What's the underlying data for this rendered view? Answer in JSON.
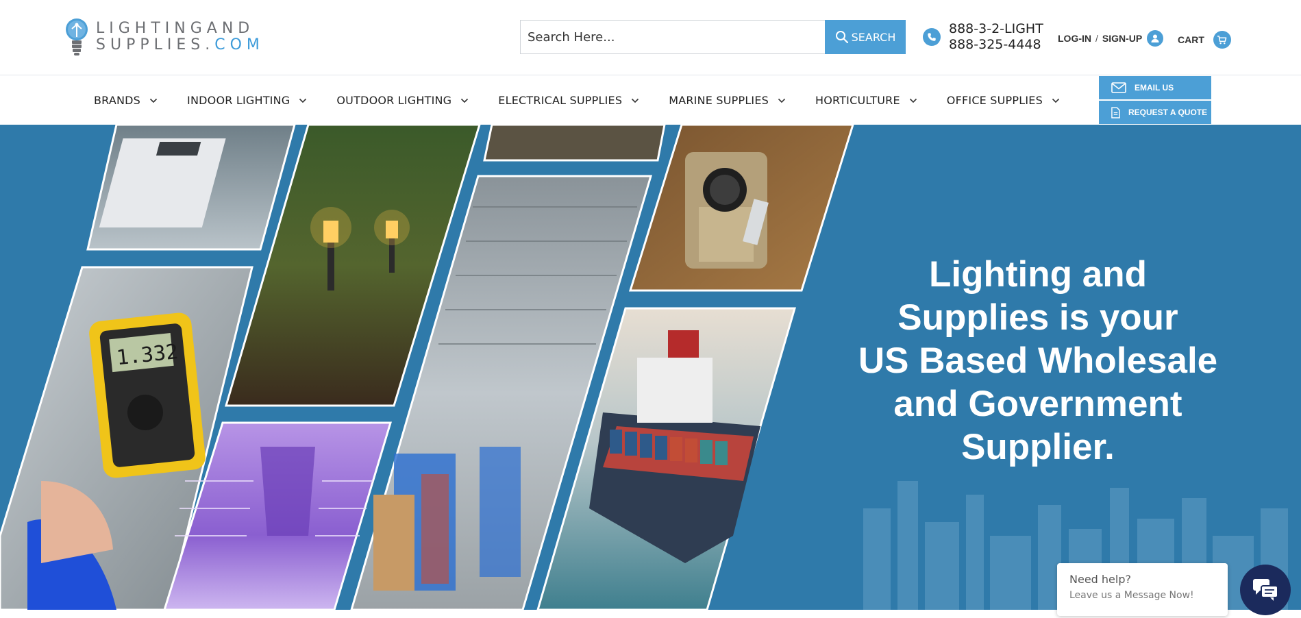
{
  "brand": {
    "line1": "LIGHTINGAND",
    "line2": "SUPPLIES.",
    "line2_suffix": "COM"
  },
  "search": {
    "placeholder": "Search Here...",
    "button_label": "SEARCH"
  },
  "contact": {
    "phone_line1": "888-3-2-LIGHT",
    "phone_line2": "888-325-4448"
  },
  "account": {
    "login_label": "LOG-IN",
    "separator": "/",
    "signup_label": "SIGN-UP"
  },
  "cart": {
    "label": "CART"
  },
  "nav": {
    "items": [
      {
        "label": "BRANDS"
      },
      {
        "label": "INDOOR LIGHTING"
      },
      {
        "label": "OUTDOOR LIGHTING"
      },
      {
        "label": "ELECTRICAL SUPPLIES"
      },
      {
        "label": "MARINE SUPPLIES"
      },
      {
        "label": "HORTICULTURE"
      },
      {
        "label": "OFFICE SUPPLIES"
      }
    ]
  },
  "quick_actions": {
    "email_label": "EMAIL US",
    "quote_label": "REQUEST A QUOTE"
  },
  "hero": {
    "headline_lines": [
      "Lighting and",
      "Supplies is your",
      "US Based Wholesale",
      "and Government",
      "Supplier."
    ],
    "multimeter_reading": "1.332"
  },
  "chat": {
    "title": "Need help?",
    "subtitle": "Leave us a Message Now!"
  },
  "colors": {
    "accent": "#4c9fd6",
    "hero_background": "#2f7aaa",
    "chat_launcher": "#1b2a5c",
    "logo_gray": "#6d6f73"
  },
  "icons": {
    "logo": "lightbulb-icon",
    "search": "search-icon",
    "phone": "phone-icon",
    "user": "user-icon",
    "cart": "cart-icon",
    "dropdown": "chevron-down-icon",
    "email": "envelope-icon",
    "quote": "document-icon",
    "chat": "chat-bubbles-icon"
  }
}
